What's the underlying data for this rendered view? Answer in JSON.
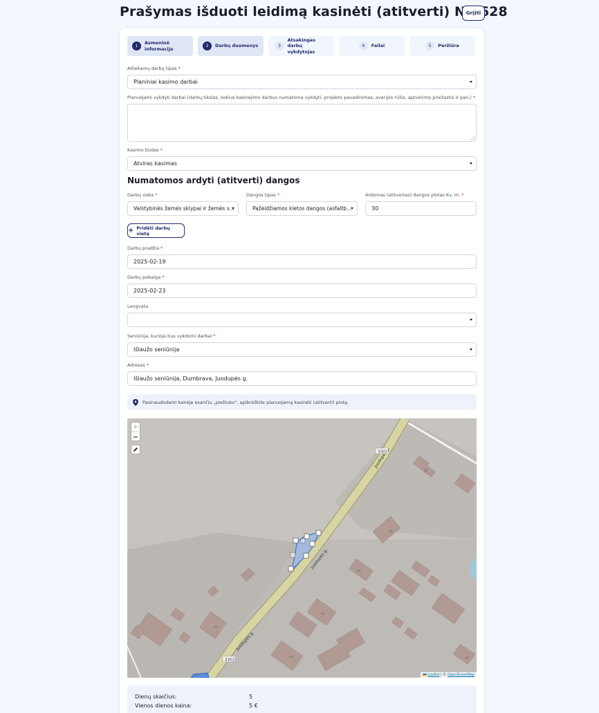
{
  "header": {
    "title": "Prašymas išduoti leidimą kasinėti (atitverti) Nr. 628",
    "back_label": "Grįžti"
  },
  "steps": [
    {
      "num": "1",
      "label": "Asmeninė informacija",
      "state": "done"
    },
    {
      "num": "2",
      "label": "Darbų duomenys",
      "state": "active"
    },
    {
      "num": "3",
      "label": "Atsakingas darbų vykdytojas",
      "state": "pending"
    },
    {
      "num": "4",
      "label": "Failai",
      "state": "pending"
    },
    {
      "num": "5",
      "label": "Peržiūra",
      "state": "pending"
    }
  ],
  "form": {
    "work_type": {
      "label": "Atliekamų darbų tipas",
      "value": "Planiniai kasimo darbai"
    },
    "planned_work": {
      "label": "Planuojami vykdyti darbai (darbų tikslas, kokius kasinėjimo darbus numatoma vykdyti, projekto pavadinimas, avarijos rūšis, aptvėrimo priežastis ir pan.)",
      "value": ""
    },
    "dig_method": {
      "label": "Kasimo būdas",
      "value": "Atviras kasimas"
    },
    "section_title": "Numatomos ardyti (atitverti) dangos",
    "work_place": {
      "label": "Darbų vieta",
      "value": "Valstybinės žemės sklypai ir žemės s..."
    },
    "surface_type": {
      "label": "Dangos tipas",
      "value": "Pažeidžiamos kietos dangos (asfaltb..."
    },
    "area": {
      "label": "Ardomas (atitvertas) dangos plotas Kv. m.",
      "value": "30"
    },
    "add_place_label": "Pridėti darbų vietą",
    "start_date": {
      "label": "Darbų pradžia",
      "value": "2025-02-19"
    },
    "end_date": {
      "label": "Darbų pabaiga",
      "value": "2025-02-23"
    },
    "discount": {
      "label": "Lengvata",
      "value": ""
    },
    "eldership": {
      "label": "Seniūnija, kurioje bus vykdomi darbai",
      "value": "Išlaužo seniūnija"
    },
    "address": {
      "label": "Adresas",
      "value": "Išlaužo seniūnija, Dumbrava, Juodupės g."
    },
    "required_mark": "*"
  },
  "info_text": "Pasinaudodami kairėje esančiu „pieštuku\", apibrėžkite planuojamą kasinėti (atitverti) plotą.",
  "map": {
    "zoom_in": "+",
    "zoom_out": "−",
    "road_name": "Juodupės g.",
    "road_code": "3302",
    "house_numbers": [
      "16",
      "36",
      "40",
      "42",
      "41",
      "44",
      "34"
    ],
    "attribution_leaflet": "Leaflet",
    "attribution_sep": " | © ",
    "attribution_osm": "OpenStreetMap"
  },
  "summary": {
    "days_label": "Dienų skaičius:",
    "days_value": "5",
    "day_price_label": "Vienos dienos kaina:",
    "day_price_value": "5 €"
  }
}
